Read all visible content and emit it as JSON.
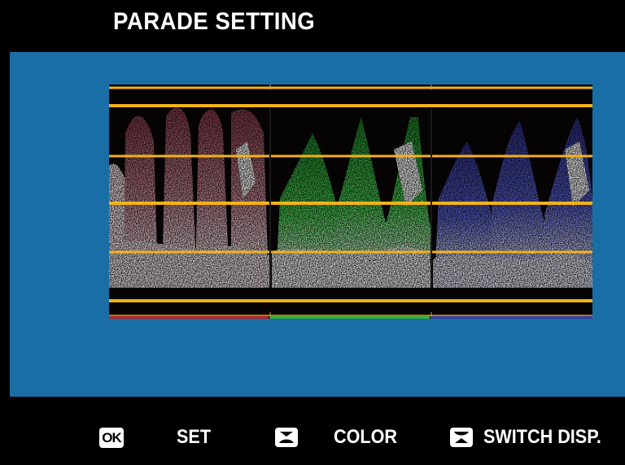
{
  "header": {
    "title": "PARADE SETTING"
  },
  "waveform": {
    "channels": [
      "red",
      "green",
      "blue"
    ],
    "colors": {
      "red": "#d89aa6",
      "green": "#3cc44a",
      "blue": "#5860d0"
    }
  },
  "footer": {
    "ok_key": "OK",
    "set_label": "SET",
    "color_label": "COLOR",
    "switch_label": "SWITCH DISP."
  },
  "theme": {
    "accent": "#1a6ea6",
    "guide_line": "#f2b21c"
  }
}
